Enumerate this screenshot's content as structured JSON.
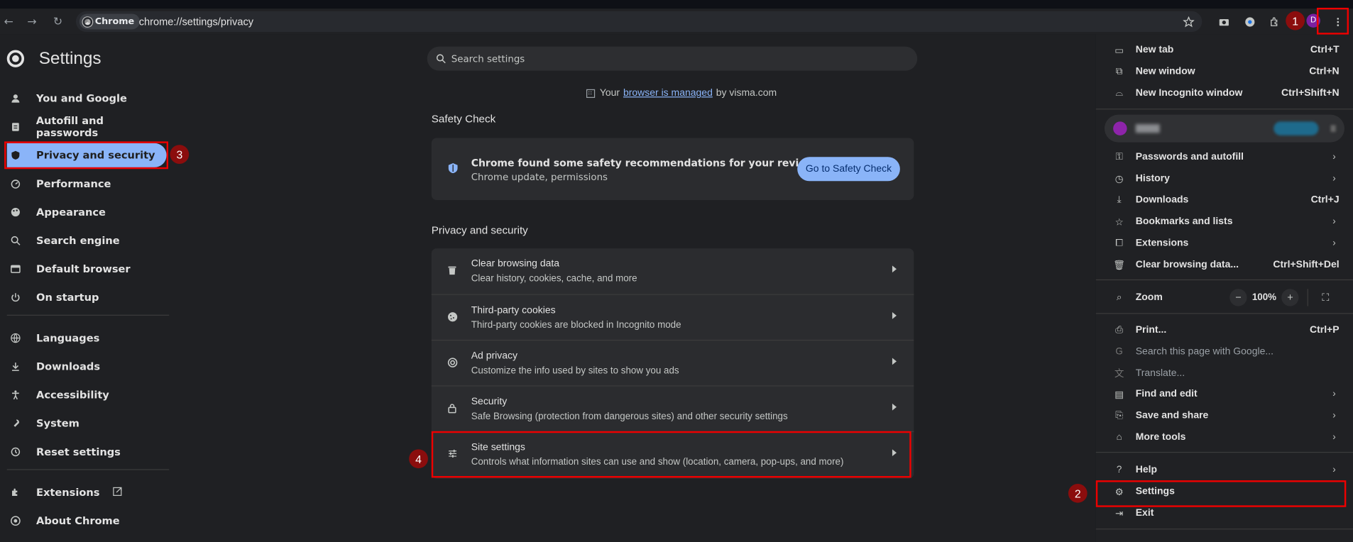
{
  "toolbar": {
    "back": "←",
    "forward": "→",
    "reload": "↻",
    "chip_label": "Chrome",
    "url": "chrome://settings/privacy",
    "avatar_letter": "D"
  },
  "settings": {
    "title": "Settings",
    "nav": [
      {
        "label": "You and Google",
        "icon": "person-icon"
      },
      {
        "label": "Autofill and passwords",
        "icon": "clipboard-icon"
      },
      {
        "label": "Privacy and security",
        "icon": "shield-icon"
      },
      {
        "label": "Performance",
        "icon": "speedometer-icon"
      },
      {
        "label": "Appearance",
        "icon": "palette-icon"
      },
      {
        "label": "Search engine",
        "icon": "search-icon"
      },
      {
        "label": "Default browser",
        "icon": "browser-icon"
      },
      {
        "label": "On startup",
        "icon": "power-icon"
      },
      {
        "label": "Languages",
        "icon": "globe-icon"
      },
      {
        "label": "Downloads",
        "icon": "download-icon"
      },
      {
        "label": "Accessibility",
        "icon": "accessibility-icon"
      },
      {
        "label": "System",
        "icon": "wrench-icon"
      },
      {
        "label": "Reset settings",
        "icon": "history-icon"
      },
      {
        "label": "Extensions",
        "icon": "puzzle-icon"
      },
      {
        "label": "About Chrome",
        "icon": "chrome-icon"
      }
    ],
    "search_placeholder": "Search settings",
    "managed_prefix": "Your",
    "managed_link": "browser is managed",
    "managed_suffix": "by visma.com",
    "safety_check": {
      "heading": "Safety Check",
      "title": "Chrome found some safety recommendations for your review",
      "subtitle": "Chrome update, permissions",
      "button": "Go to Safety Check"
    },
    "privacy": {
      "heading": "Privacy and security",
      "rows": [
        {
          "title": "Clear browsing data",
          "subtitle": "Clear history, cookies, cache, and more"
        },
        {
          "title": "Third-party cookies",
          "subtitle": "Third-party cookies are blocked in Incognito mode"
        },
        {
          "title": "Ad privacy",
          "subtitle": "Customize the info used by sites to show you ads"
        },
        {
          "title": "Security",
          "subtitle": "Safe Browsing (protection from dangerous sites) and other security settings"
        },
        {
          "title": "Site settings",
          "subtitle": "Controls what information sites can use and show (location, camera, pop-ups, and more)"
        }
      ]
    }
  },
  "menu": {
    "items": {
      "new_tab": {
        "label": "New tab",
        "shortcut": "Ctrl+T"
      },
      "new_window": {
        "label": "New window",
        "shortcut": "Ctrl+N"
      },
      "incognito": {
        "label": "New Incognito window",
        "shortcut": "Ctrl+Shift+N"
      },
      "passwords": {
        "label": "Passwords and autofill"
      },
      "history": {
        "label": "History"
      },
      "downloads": {
        "label": "Downloads",
        "shortcut": "Ctrl+J"
      },
      "bookmarks": {
        "label": "Bookmarks and lists"
      },
      "extensions": {
        "label": "Extensions"
      },
      "clear": {
        "label": "Clear browsing data...",
        "shortcut": "Ctrl+Shift+Del"
      },
      "zoom": {
        "label": "Zoom",
        "value": "100%",
        "minus": "−",
        "plus": "+"
      },
      "print": {
        "label": "Print...",
        "shortcut": "Ctrl+P"
      },
      "search_google": {
        "label": "Search this page with Google..."
      },
      "translate": {
        "label": "Translate..."
      },
      "find_edit": {
        "label": "Find and edit"
      },
      "save_share": {
        "label": "Save and share"
      },
      "more_tools": {
        "label": "More tools"
      },
      "help": {
        "label": "Help"
      },
      "settings": {
        "label": "Settings"
      },
      "exit": {
        "label": "Exit"
      }
    }
  },
  "annotations": {
    "badge1": "1",
    "badge2": "2",
    "badge3": "3",
    "badge4": "4"
  },
  "colors": {
    "accent": "#8ab4f8",
    "highlight": "#e00000",
    "badge": "#8b0d0d"
  }
}
